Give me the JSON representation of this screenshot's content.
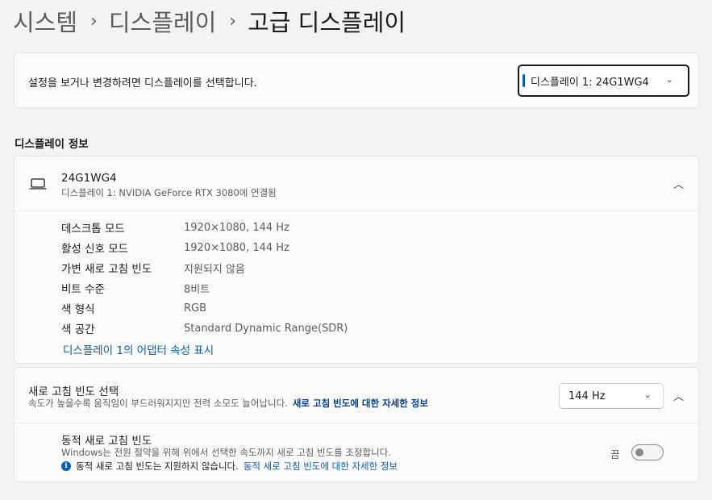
{
  "breadcrumb": {
    "items": [
      "시스템",
      "디스플레이"
    ],
    "separator": "›",
    "current": "고급 디스플레이"
  },
  "select_card": {
    "description": "설정을 보거나 변경하려면 디스플레이를 선택합니다.",
    "dropdown_value": "디스플레이 1: 24G1WG4",
    "chevron": "⌄"
  },
  "info_section": {
    "header": "디스플레이 정보",
    "device_name": "24G1WG4",
    "device_sub": "디스플레이 1: NVIDIA GeForce RTX 3080에 연결됨",
    "collapse_chevron": "︿",
    "rows": [
      {
        "label": "데스크톱 모드",
        "value": "1920×1080, 144 Hz"
      },
      {
        "label": "활성 신호 모드",
        "value": "1920×1080, 144 Hz"
      },
      {
        "label": "가변 새로 고침 빈도",
        "value": "지원되지 않음"
      },
      {
        "label": "비트 수준",
        "value": "8비트"
      },
      {
        "label": "색 형식",
        "value": "RGB"
      },
      {
        "label": "색 공간",
        "value": "Standard Dynamic Range(SDR)"
      }
    ],
    "adapter_link": "디스플레이 1의 어댑터 속성 표시"
  },
  "refresh_section": {
    "title": "새로 고침 빈도 선택",
    "subtitle": "속도가 높을수록 움직임이 부드러워지지만 전력 소모도 늘어납니다.",
    "more_link": "새로 고침 빈도에 대한 자세한 정보",
    "rate_value": "144 Hz",
    "chevron": "⌄",
    "collapse_chevron": "︿"
  },
  "dynamic_refresh": {
    "title": "동적 새로 고침 빈도",
    "subtitle": "Windows는 전원 절약을 위해 위에서 선택한 속도까지 새로 고침 빈도를 조정합니다.",
    "info_glyph": "i",
    "note": "동적 새로 고침 빈도는 지원하지 않습니다.",
    "note_link": "동적 새로 고침 빈도에 대한 자세한 정보",
    "toggle_state_label": "끔",
    "toggle_on": false
  },
  "colors": {
    "accent": "#005fb8",
    "link": "#0f5ba7",
    "background": "#f3f3f3",
    "card": "#fbfbfb"
  }
}
